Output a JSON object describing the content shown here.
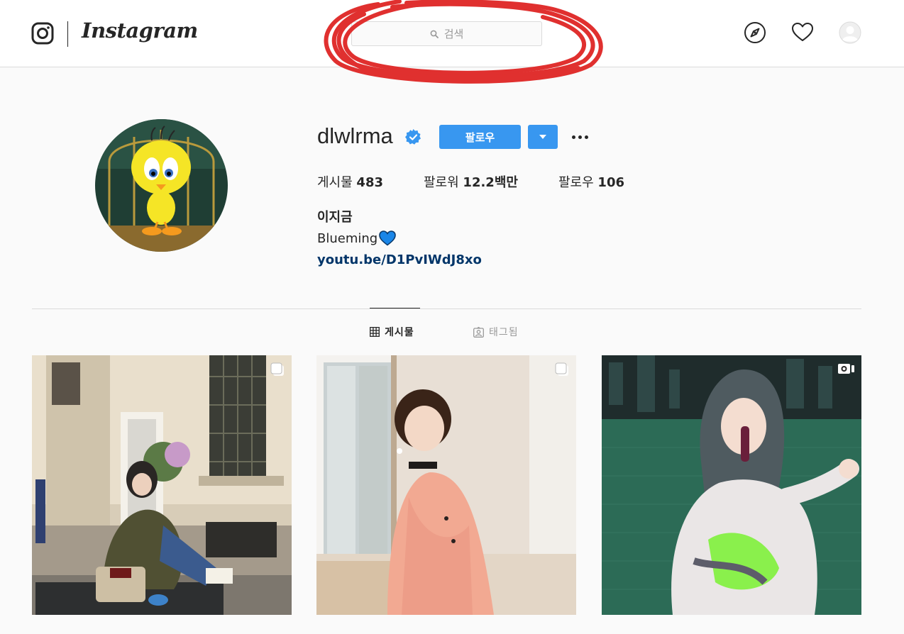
{
  "nav": {
    "wordmark": "Instagram",
    "search_placeholder": "검색",
    "icons": [
      "instagram-glyph-icon",
      "search-icon",
      "compass-icon",
      "heart-icon",
      "profile-avatar-icon"
    ]
  },
  "profile": {
    "username": "dlwlrma",
    "verified": true,
    "follow_label": "팔로우",
    "stats": [
      {
        "label": "게시물",
        "value": "483"
      },
      {
        "label": "팔로워",
        "value": "12.2백만"
      },
      {
        "label": "팔로우",
        "value": "106"
      }
    ],
    "full_name": "이지금",
    "bio": "Blueming",
    "bio_emoji": "blue-heart",
    "link": "youtu.be/D1PvIWdJ8xo"
  },
  "tabs": [
    {
      "label": "게시물",
      "icon": "grid-icon",
      "active": true
    },
    {
      "label": "태그됨",
      "icon": "tagged-icon",
      "active": false
    }
  ],
  "posts": [
    {
      "name": "post-street-night",
      "badge": "carousel-icon"
    },
    {
      "name": "post-window-portrait",
      "badge": "carousel-icon"
    },
    {
      "name": "post-stage-performance",
      "badge": "video-icon"
    }
  ],
  "colors": {
    "accent": "#3897f0",
    "link": "#003569",
    "verified": "#3897f0",
    "annotation_circle": "#e0302f"
  }
}
